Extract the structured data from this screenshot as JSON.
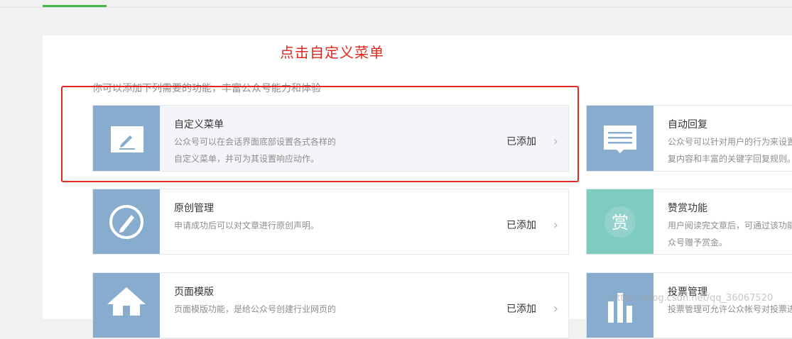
{
  "annotation": "点击自定义菜单",
  "intro": "你可以添加下列需要的功能，丰富公众号能力和体验",
  "colors": {
    "accent_green": "#44b549",
    "icon_blue": "#88acce",
    "icon_teal": "#7fcbc2",
    "annotation_red": "#e0281e"
  },
  "cards": [
    {
      "icon": "edit-icon",
      "title": "自定义菜单",
      "desc": [
        "公众号可以在会话界面底部设置各式各样的",
        "自定义菜单，并可为其设置响应动作。"
      ],
      "status": "已添加",
      "chevron": "›"
    },
    {
      "icon": "message-icon",
      "title": "自动回复",
      "desc": [
        "公众号可以针对用户的行为来设置",
        "复内容和丰富的关键字回复规则。"
      ],
      "status": "",
      "chevron": ""
    },
    {
      "icon": "original-pen-icon",
      "title": "原创管理",
      "desc": [
        "申请成功后可以对文章进行原创声明。"
      ],
      "status": "已添加",
      "chevron": "›"
    },
    {
      "icon": "reward-icon",
      "icon_text": "赏",
      "title": "赞赏功能",
      "desc": [
        "用户阅读完文章后，可通过该功能",
        "众号赠予赏金。"
      ],
      "status": "",
      "chevron": ""
    },
    {
      "icon": "house-icon",
      "title": "页面模版",
      "desc": [
        "页面模版功能，是给公众号创建行业网页的"
      ],
      "status": "已添加",
      "chevron": "›"
    },
    {
      "icon": "bar-chart-icon",
      "title": "投票管理",
      "desc": [
        "投票管理可允许公众帐号对投票进"
      ],
      "status": "",
      "chevron": ""
    }
  ],
  "watermark": "https://blog.csdn.net/qq_36067520"
}
